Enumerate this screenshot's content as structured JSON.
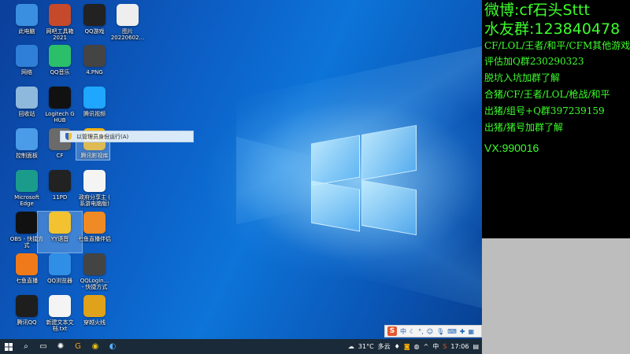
{
  "desktop_icons": [
    {
      "label": "此电脑",
      "icon": "computer-icon",
      "color": "#3b8fe0"
    },
    {
      "label": "网吧工具箱\n2021",
      "icon": "toolbox-icon",
      "color": "#c44a2b"
    },
    {
      "label": "QQ游戏",
      "icon": "qq-game-icon",
      "color": "#222222"
    },
    {
      "label": "图片\n20220602...",
      "icon": "image-file-icon",
      "color": "#eeeeee"
    },
    {
      "label": "网络",
      "icon": "network-icon",
      "color": "#2f7fd8"
    },
    {
      "label": "QQ音乐",
      "icon": "qq-music-icon",
      "color": "#2bbf6a"
    },
    {
      "label": "4.PNG",
      "icon": "png-file-icon",
      "color": "#444444"
    },
    {
      "label": "回收站",
      "icon": "recycle-bin-icon",
      "color": "#8fb8dd"
    },
    {
      "label": "Logitech G\nHUB",
      "icon": "logitech-icon",
      "color": "#111111"
    },
    {
      "label": "腾讯视频",
      "icon": "tencent-video-icon",
      "color": "#1fa6ff"
    },
    {
      "label": "控制面板",
      "icon": "control-panel-icon",
      "color": "#4a9be8"
    },
    {
      "label": "CF",
      "icon": "cf-icon",
      "color": "#6a6a6a"
    },
    {
      "label": "腾讯影视库",
      "icon": "video-library-icon",
      "color": "#ffb400"
    },
    {
      "label": "Microsoft\nEdge",
      "icon": "edge-icon",
      "color": "#1a9b8c"
    },
    {
      "label": "11PD",
      "icon": "app-11pd-icon",
      "color": "#222222"
    },
    {
      "label": "政府分享主 (\n系游电脑版)",
      "icon": "shortcut-file-icon",
      "color": "#f4f4f4"
    },
    {
      "label": "OBS - 快捷方\n式",
      "icon": "obs-icon",
      "color": "#111111"
    },
    {
      "label": "YY语音",
      "icon": "yy-icon",
      "color": "#f2c230"
    },
    {
      "label": "七鱼直播伴侣",
      "icon": "qiyu-live-icon",
      "color": "#f08a24"
    },
    {
      "label": "七鱼直播",
      "icon": "qiyu-icon",
      "color": "#f07a1a"
    },
    {
      "label": "QQ浏览器",
      "icon": "qq-browser-icon",
      "color": "#2f8ee6"
    },
    {
      "label": "QQLogin...\n- 快捷方式",
      "icon": "qq-login-icon",
      "color": "#444444"
    },
    {
      "label": "腾讯QQ",
      "icon": "qq-icon",
      "color": "#1e1e1e"
    },
    {
      "label": "新建文本文\n档.txt",
      "icon": "text-file-icon",
      "color": "#f4f4f4"
    },
    {
      "label": "穿越火线",
      "icon": "crossfire-icon",
      "color": "#e0a21a"
    }
  ],
  "context_menu": {
    "item": "以管理员身份运行(A)"
  },
  "taskbar": {
    "weather_temp": "31°C",
    "weather_desc": "多云",
    "ime_mode": "中",
    "clock": "17:06"
  },
  "ime_toolbar": {
    "logo": "S",
    "mode": "中"
  },
  "stream_overlay": {
    "lines": [
      "微博:cf石头Sttt",
      "水友群:123840478",
      "CF/LOL/王者/和平/CFM其他游戏",
      "评估加Q群230290323",
      "脱坑入坑加群了解",
      "合猪/CF/王者/LOL/枪战/和平",
      "出猪/组号+Q群397239159",
      "出猪/猪号加群了解",
      "VX:990016"
    ],
    "text_color": "#3dff2b"
  }
}
